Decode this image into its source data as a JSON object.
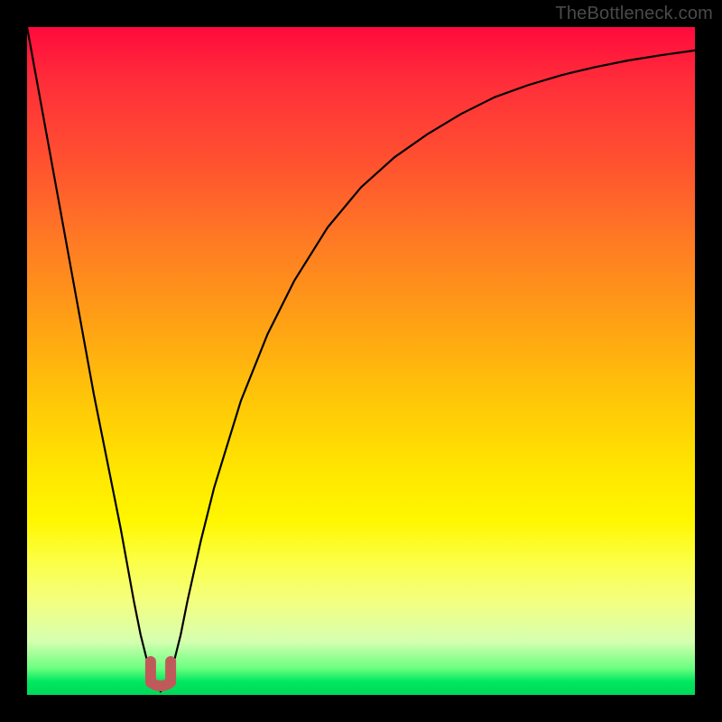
{
  "watermark": "TheBottleneck.com",
  "chart_data": {
    "type": "line",
    "title": "",
    "xlabel": "",
    "ylabel": "",
    "xlim": [
      0,
      100
    ],
    "ylim": [
      0,
      100
    ],
    "notch_x": 20,
    "series": [
      {
        "name": "curve",
        "x": [
          0,
          2,
          4,
          6,
          8,
          10,
          12,
          14,
          16,
          17,
          18,
          19,
          20,
          21,
          22,
          23,
          24,
          26,
          28,
          32,
          36,
          40,
          45,
          50,
          55,
          60,
          65,
          70,
          75,
          80,
          85,
          90,
          95,
          100
        ],
        "y": [
          100,
          89,
          78,
          67,
          56,
          45,
          35,
          25,
          14,
          9,
          5,
          2,
          0.5,
          2,
          5,
          9,
          14,
          23,
          31,
          44,
          54,
          62,
          70,
          76,
          80.5,
          84,
          87,
          89.5,
          91.3,
          92.8,
          94,
          95,
          95.8,
          96.5
        ]
      }
    ],
    "marker": {
      "name": "notch-marker",
      "x_range": [
        18.5,
        21.5
      ],
      "y_range": [
        0,
        5
      ],
      "color": "#c05a5a"
    },
    "colors": {
      "curve": "#000000",
      "background_top": "#ff0a3c",
      "background_bottom": "#00d85a"
    }
  }
}
